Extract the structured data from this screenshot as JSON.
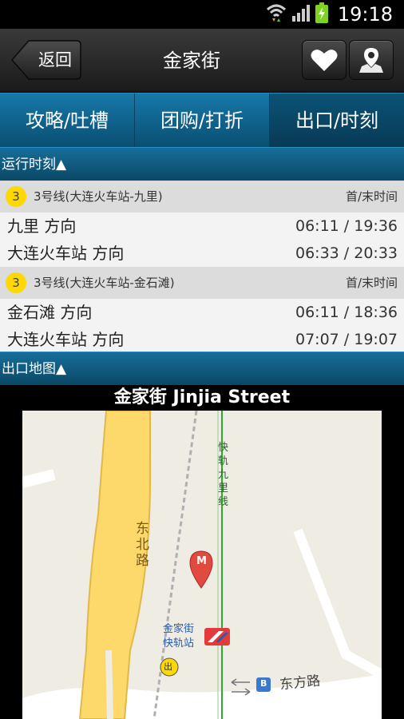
{
  "status": {
    "time": "19:18"
  },
  "titlebar": {
    "back_label": "返回",
    "title": "金家街"
  },
  "tabs": [
    {
      "label": "攻略/吐槽"
    },
    {
      "label": "团购/打折"
    },
    {
      "label": "出口/时刻"
    }
  ],
  "schedule": {
    "header": "运行时刻▲",
    "lines": [
      {
        "badge": "3",
        "name": "3号线(大连火车站-九里)",
        "time_label": "首/末时间",
        "directions": [
          {
            "name": "九里  方向",
            "times": "06:11 / 19:36"
          },
          {
            "name": "大连火车站  方向",
            "times": "06:33 / 20:33"
          }
        ]
      },
      {
        "badge": "3",
        "name": "3号线(大连火车站-金石滩)",
        "time_label": "首/末时间",
        "directions": [
          {
            "name": "金石滩  方向",
            "times": "06:11 / 18:36"
          },
          {
            "name": "大连火车站  方向",
            "times": "07:07 / 19:07"
          }
        ]
      }
    ]
  },
  "exit_map": {
    "header": "出口地图▲",
    "title": "金家街 Jinjia Street",
    "labels": {
      "road_dongbei": "东北路",
      "line_name": "快轨九里线",
      "station_line1": "金家街",
      "station_line2": "快轨站",
      "exit_mark": "出",
      "road_dongfang": "东方路",
      "pin_letter": "M",
      "bus_mark": "B"
    }
  },
  "colors": {
    "accent_blue": "#0b5376",
    "line3_yellow": "#ffd800",
    "road_yellow": "#fcd96a",
    "rail_green": "#2fa82f",
    "pin_red": "#e04a3f"
  }
}
